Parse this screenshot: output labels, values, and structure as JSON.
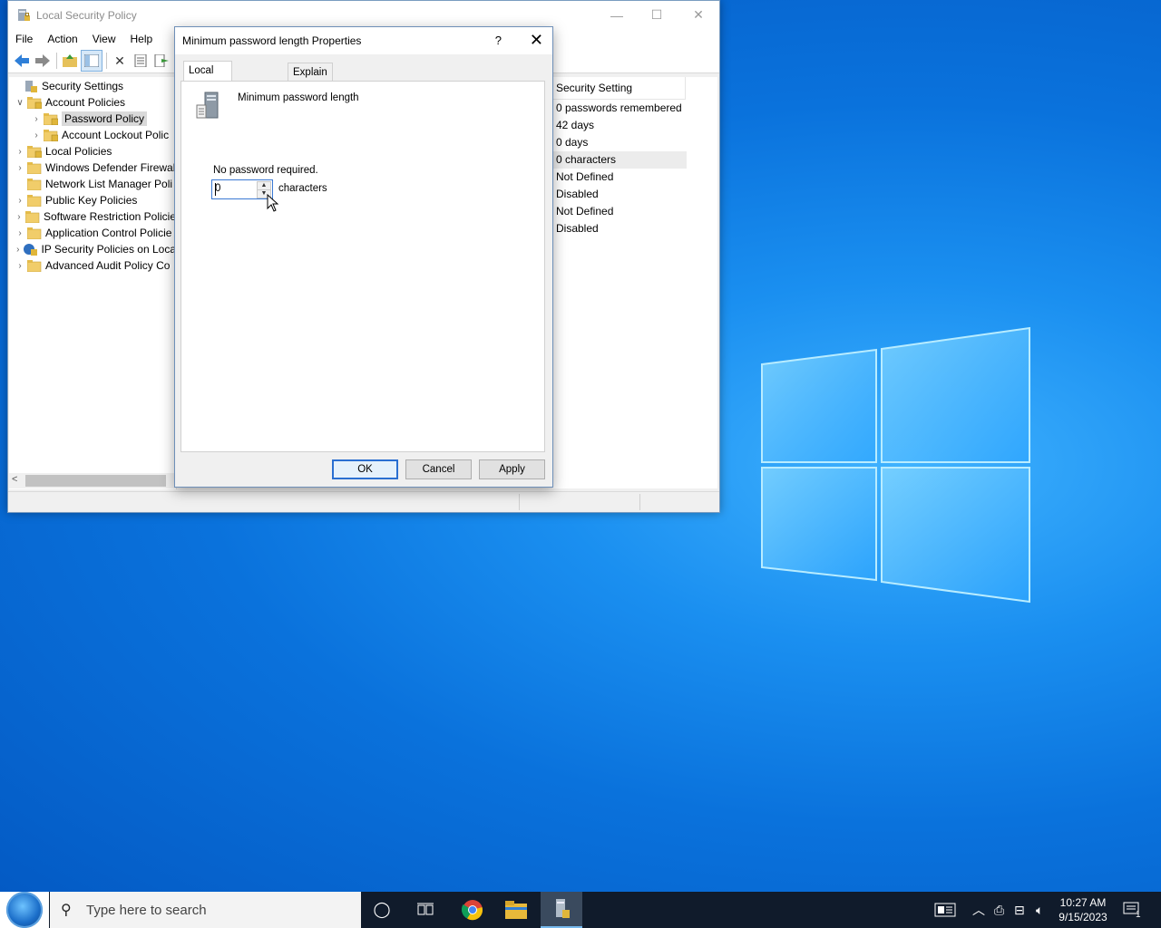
{
  "desktop": {
    "logo": "windows-logo"
  },
  "mmc": {
    "title": "Local Security Policy",
    "menu": [
      "File",
      "Action",
      "View",
      "Help"
    ],
    "toolbar_icons": [
      "back-icon",
      "forward-icon",
      "up-folder-icon",
      "show-hide-tree-icon",
      "delete-icon",
      "properties-icon",
      "export-icon"
    ],
    "tree": [
      {
        "label": "Security Settings",
        "level": 0,
        "expander": "",
        "icon": "security-settings-icon"
      },
      {
        "label": "Account Policies",
        "level": 1,
        "expander": "∨",
        "icon": "folder-lock-icon"
      },
      {
        "label": "Password Policy",
        "level": 2,
        "expander": "›",
        "icon": "folder-lock-icon",
        "selected": true
      },
      {
        "label": "Account Lockout Polic",
        "level": 2,
        "expander": "›",
        "icon": "folder-lock-icon"
      },
      {
        "label": "Local Policies",
        "level": 1,
        "expander": "›",
        "icon": "folder-lock-icon"
      },
      {
        "label": "Windows Defender Firewal",
        "level": 1,
        "expander": "›",
        "icon": "folder-icon"
      },
      {
        "label": "Network List Manager Poli",
        "level": 1,
        "expander": "",
        "icon": "folder-icon"
      },
      {
        "label": "Public Key Policies",
        "level": 1,
        "expander": "›",
        "icon": "folder-icon"
      },
      {
        "label": "Software Restriction Policie",
        "level": 1,
        "expander": "›",
        "icon": "folder-icon"
      },
      {
        "label": "Application Control Policie",
        "level": 1,
        "expander": "›",
        "icon": "folder-icon"
      },
      {
        "label": "IP Security Policies on Loca",
        "level": 1,
        "expander": "›",
        "icon": "ip-security-icon"
      },
      {
        "label": "Advanced Audit Policy Co",
        "level": 1,
        "expander": "›",
        "icon": "folder-icon"
      }
    ],
    "right_header": "Security Setting",
    "right_values": [
      "0 passwords remembered",
      "42 days",
      "0 days",
      "0 characters",
      "Not Defined",
      "Disabled",
      "Not Defined",
      "Disabled"
    ],
    "highlight_index": 3
  },
  "dialog": {
    "title": "Minimum password length Properties",
    "help": "?",
    "close": "✕",
    "tabs": [
      "Local Security Setting",
      "Explain"
    ],
    "policy_name": "Minimum password length",
    "note": "No password required.",
    "value": "0",
    "unit": "characters",
    "buttons": {
      "ok": "OK",
      "cancel": "Cancel",
      "apply": "Apply"
    }
  },
  "taskbar": {
    "search_placeholder": "Type here to search",
    "time": "10:27 AM",
    "date": "9/15/2023",
    "notification_count": "1"
  }
}
